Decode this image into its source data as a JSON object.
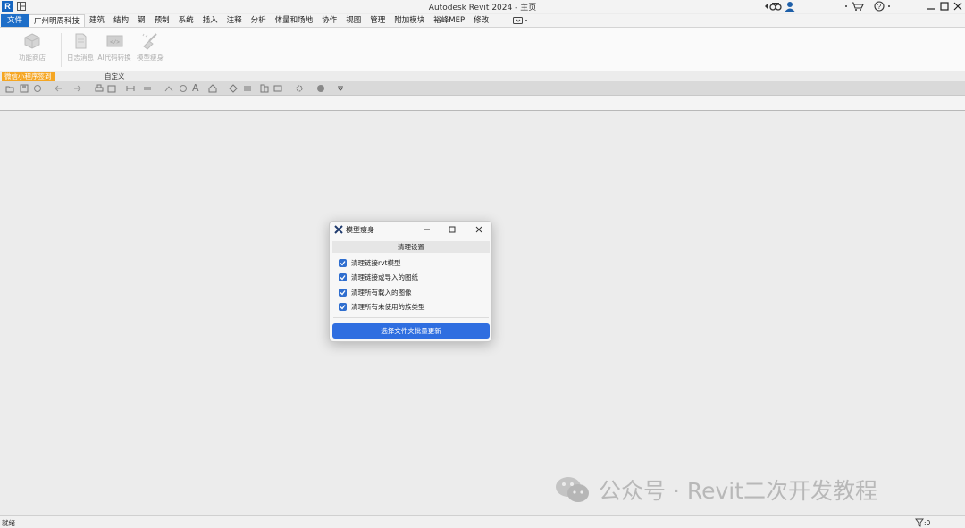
{
  "app": {
    "logo_letter": "R",
    "window_title": "Autodesk Revit 2024 - 主页"
  },
  "ribbon": {
    "tabs": [
      "文件",
      "广州明周科技",
      "建筑",
      "结构",
      "钢",
      "预制",
      "系统",
      "插入",
      "注释",
      "分析",
      "体量和场地",
      "协作",
      "视图",
      "管理",
      "附加模块",
      "裕峰MEP",
      "修改"
    ],
    "active_tab_index": 1,
    "buttons": [
      {
        "label": "功能商店",
        "icon": "cube-icon"
      },
      {
        "label": "日志消息",
        "icon": "document-icon"
      },
      {
        "label": "AI代码转换",
        "icon": "code-icon"
      },
      {
        "label": "模型瘦身",
        "icon": "broom-icon"
      }
    ],
    "panel_labels": {
      "wechat": "微信小程序签到",
      "custom": "自定义"
    }
  },
  "dialog": {
    "title": "模型瘦身",
    "header": "清理设置",
    "options": [
      {
        "label": "清理链接rvt模型",
        "checked": true
      },
      {
        "label": "清理链接或导入的图纸",
        "checked": true
      },
      {
        "label": "清理所有载入的图像",
        "checked": true
      },
      {
        "label": "清理所有未使用的族类型",
        "checked": true
      }
    ],
    "action_button": "选择文件夹批量更新"
  },
  "watermark": {
    "text": "公众号 · Revit二次开发教程"
  },
  "statusbar": {
    "status": "就绪",
    "filter_count": ":0"
  },
  "colors": {
    "accent": "#2f6ee0",
    "file_tab": "#1e6ec8",
    "panel_highlight": "#f5a623"
  }
}
